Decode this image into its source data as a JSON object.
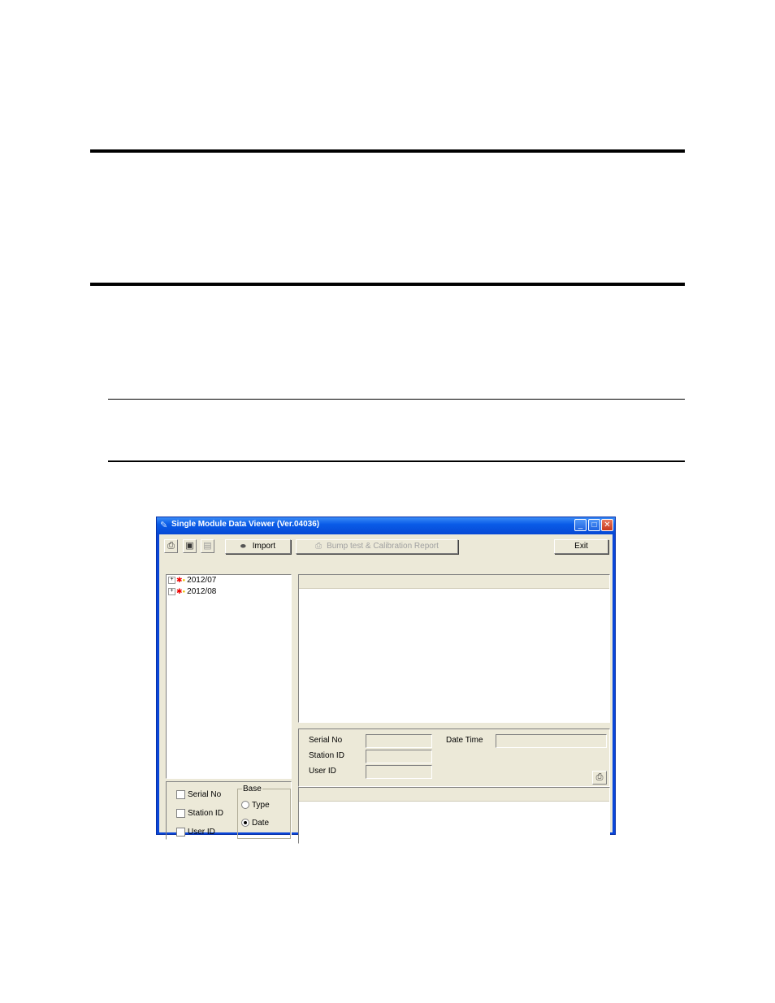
{
  "window": {
    "title": "Single Module Data Viewer (Ver.04036)",
    "minimize_glyph": "_",
    "maximize_glyph": "□",
    "close_glyph": "✕"
  },
  "toolbar": {
    "print_icon": "printer-icon",
    "save_icon": "floppy-disk-icon",
    "clipboard_icon": "clipboard-icon",
    "import_label": "Import",
    "report_label": "Bump test & Calibration Report",
    "exit_label": "Exit"
  },
  "tree": {
    "items": [
      {
        "label": "2012/07"
      },
      {
        "label": "2012/08"
      }
    ]
  },
  "details": {
    "serial_no_label": "Serial No",
    "station_id_label": "Station ID",
    "user_id_label": "User ID",
    "date_time_label": "Date Time"
  },
  "filters": {
    "serial_no": "Serial No",
    "station_id": "Station ID",
    "user_id": "User ID",
    "base_title": "Base",
    "type_label": "Type",
    "date_label": "Date",
    "selected": "Date"
  }
}
